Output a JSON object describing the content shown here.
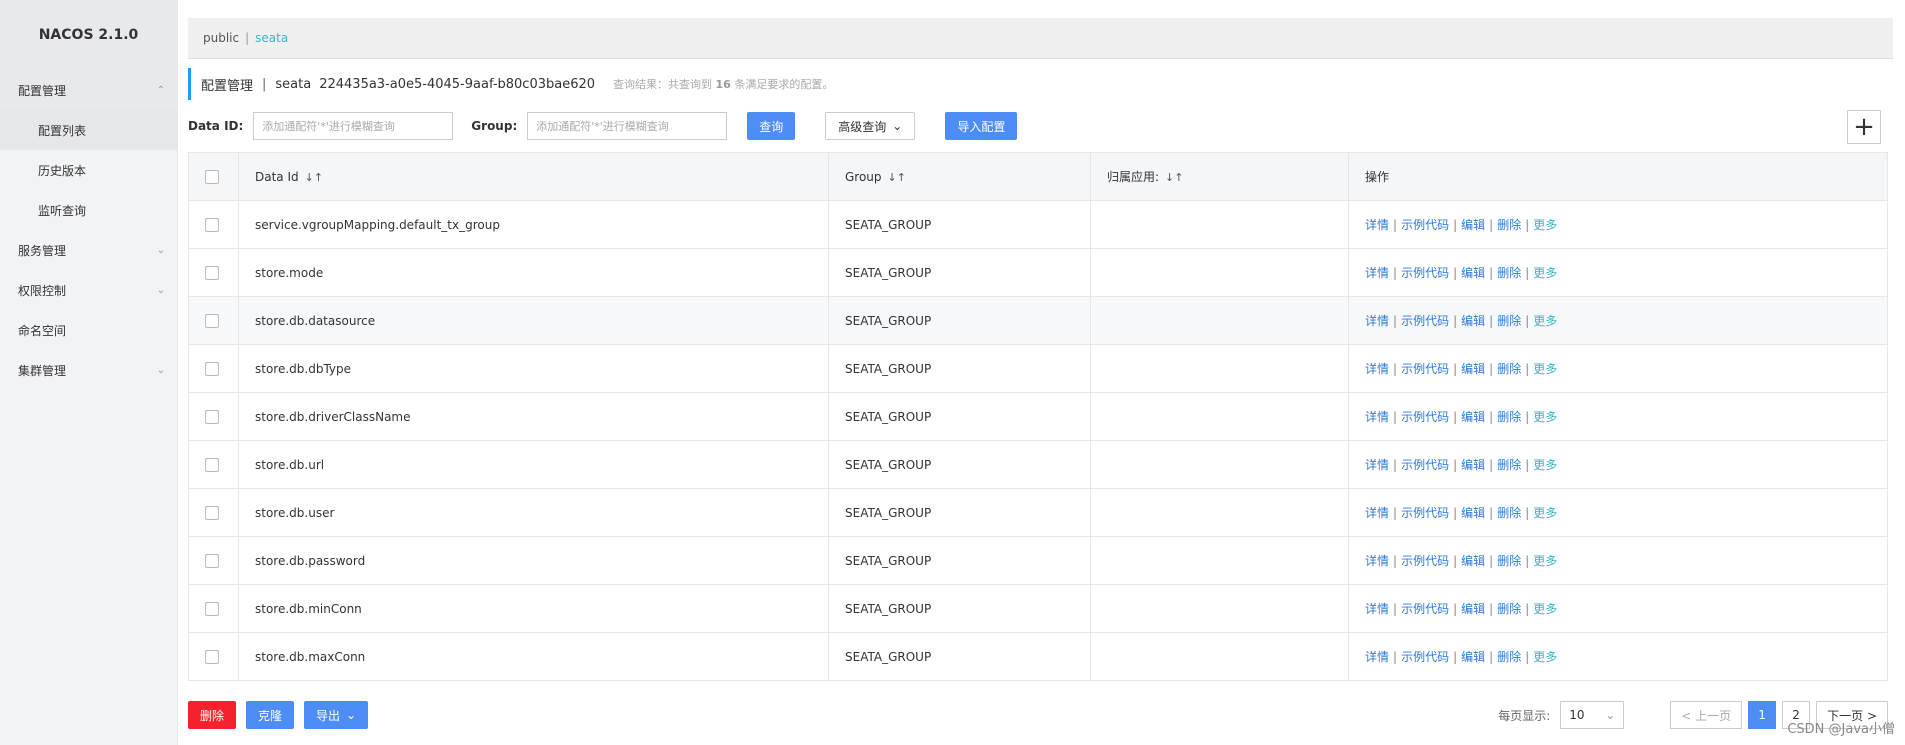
{
  "sidebar": {
    "brand": "NACOS 2.1.0",
    "menus": [
      {
        "label": "配置管理",
        "expanded": true,
        "children": [
          "配置列表",
          "历史版本",
          "监听查询"
        ]
      },
      {
        "label": "服务管理",
        "expanded": false
      },
      {
        "label": "权限控制",
        "expanded": false
      },
      {
        "label": "命名空间",
        "expanded": false
      },
      {
        "label": "集群管理",
        "expanded": false
      }
    ]
  },
  "namespaces": {
    "items": [
      "public",
      "seata"
    ],
    "active": "seata"
  },
  "header": {
    "title": "配置管理",
    "namespace": "seata",
    "namespace_id": "224435a3-a0e5-4045-9aaf-b80c03bae620",
    "result_prefix": "查询结果：共查询到",
    "result_count": "16",
    "result_suffix": "条满足要求的配置。"
  },
  "search": {
    "dataid_label": "Data ID:",
    "dataid_placeholder": "添加通配符'*'进行模糊查询",
    "group_label": "Group:",
    "group_placeholder": "添加通配符'*'进行模糊查询",
    "query_btn": "查询",
    "advanced_btn": "高级查询",
    "import_btn": "导入配置",
    "add_btn": "+"
  },
  "table": {
    "columns": [
      "Data Id",
      "Group",
      "归属应用:",
      "操作"
    ],
    "rows": [
      {
        "data_id": "service.vgroupMapping.default_tx_group",
        "group": "SEATA_GROUP",
        "app": ""
      },
      {
        "data_id": "store.mode",
        "group": "SEATA_GROUP",
        "app": ""
      },
      {
        "data_id": "store.db.datasource",
        "group": "SEATA_GROUP",
        "app": ""
      },
      {
        "data_id": "store.db.dbType",
        "group": "SEATA_GROUP",
        "app": ""
      },
      {
        "data_id": "store.db.driverClassName",
        "group": "SEATA_GROUP",
        "app": ""
      },
      {
        "data_id": "store.db.url",
        "group": "SEATA_GROUP",
        "app": ""
      },
      {
        "data_id": "store.db.user",
        "group": "SEATA_GROUP",
        "app": ""
      },
      {
        "data_id": "store.db.password",
        "group": "SEATA_GROUP",
        "app": ""
      },
      {
        "data_id": "store.db.minConn",
        "group": "SEATA_GROUP",
        "app": ""
      },
      {
        "data_id": "store.db.maxConn",
        "group": "SEATA_GROUP",
        "app": ""
      }
    ],
    "ops": [
      "详情",
      "示例代码",
      "编辑",
      "删除",
      "更多"
    ]
  },
  "footer": {
    "delete_btn": "删除",
    "clone_btn": "克隆",
    "export_btn": "导出",
    "page_size_label": "每页显示:",
    "page_size": "10",
    "prev": "< 上一页",
    "pages": [
      "1",
      "2"
    ],
    "current_page": "1",
    "next": "下一页 >"
  },
  "watermark": "CSDN @Java小僧"
}
